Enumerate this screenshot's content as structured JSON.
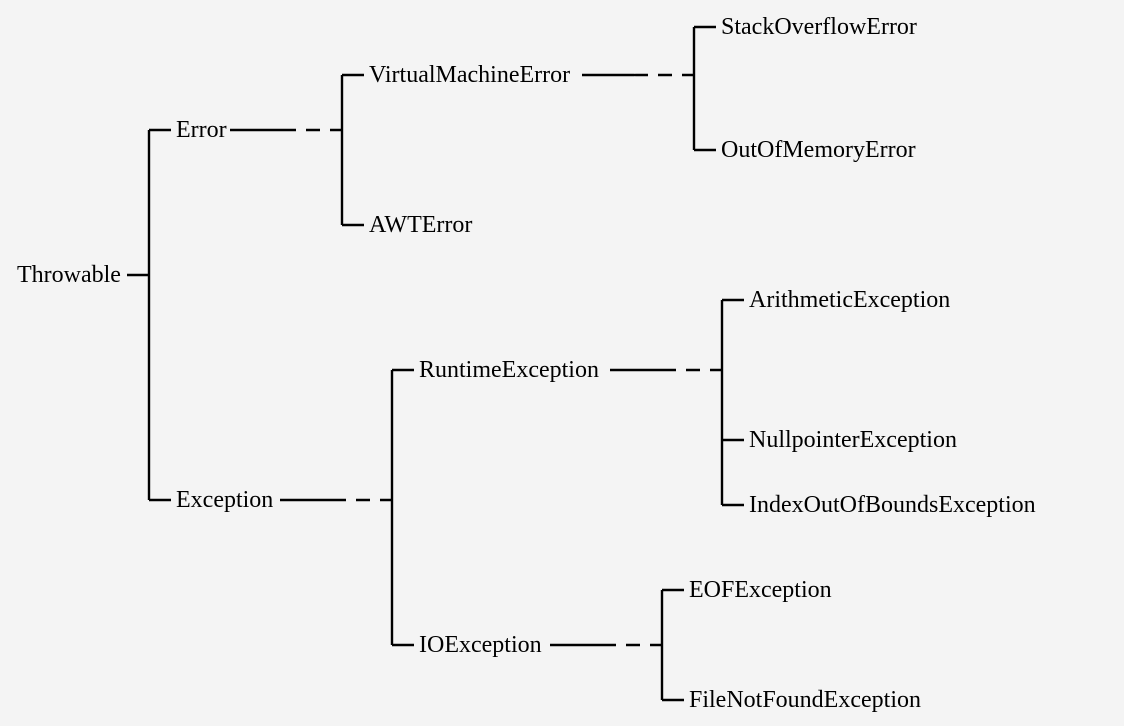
{
  "tree": {
    "root": "Throwable",
    "error": {
      "label": "Error",
      "children": {
        "vm": {
          "label": "VirtualMachineError",
          "children": {
            "stackoverflow": "StackOverflowError",
            "oom": "OutOfMemoryError"
          }
        },
        "awt": {
          "label": "AWTError"
        }
      }
    },
    "exception": {
      "label": "Exception",
      "children": {
        "runtime": {
          "label": "RuntimeException",
          "children": {
            "arith": "ArithmeticException",
            "npe": "NullpointerException",
            "ioob": "IndexOutOfBoundsException"
          }
        },
        "io": {
          "label": "IOException",
          "children": {
            "eof": "EOFException",
            "fnf": "FileNotFoundException"
          }
        }
      }
    }
  }
}
